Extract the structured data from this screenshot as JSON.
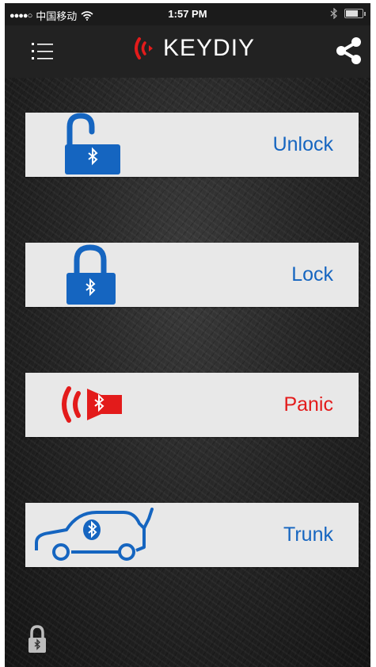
{
  "status_bar": {
    "signal": "●●●●○",
    "carrier": "中国移动",
    "time": "1:57 PM"
  },
  "header": {
    "brand": "KEYDIY",
    "icons": {
      "menu": "list-menu-icon",
      "share": "share-icon",
      "logo": "signal-waves-logo-icon"
    }
  },
  "actions": [
    {
      "id": "unlock",
      "label": "Unlock",
      "icon": "unlocked-padlock-bluetooth-icon",
      "color": "#1565c0"
    },
    {
      "id": "lock",
      "label": "Lock",
      "icon": "locked-padlock-bluetooth-icon",
      "color": "#1565c0"
    },
    {
      "id": "panic",
      "label": "Panic",
      "icon": "alarm-speaker-bluetooth-icon",
      "color": "#e31b1b"
    },
    {
      "id": "trunk",
      "label": "Trunk",
      "icon": "car-trunk-bluetooth-icon",
      "color": "#1565c0"
    }
  ],
  "footer": {
    "icon": "bluetooth-lock-status-icon"
  },
  "colors": {
    "accent_blue": "#1565c0",
    "panic_red": "#e31b1b",
    "brand_red": "#e31b1b",
    "button_bg": "#e8e8e8"
  }
}
